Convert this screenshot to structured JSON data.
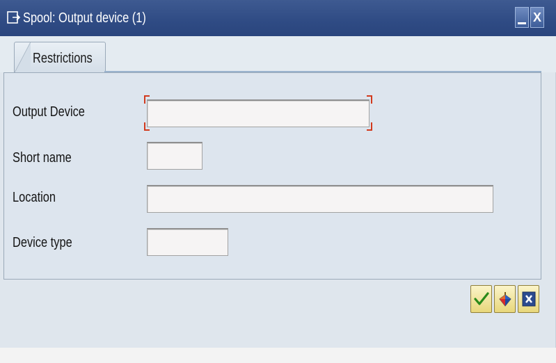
{
  "window": {
    "title": "Spool: Output device (1)",
    "title_icon": "dialog-icon",
    "minimize_icon": "minimize-icon",
    "close_label": "X"
  },
  "tabs": [
    {
      "label": "Restrictions",
      "active": true
    }
  ],
  "form": {
    "fields": [
      {
        "label": "Output Device",
        "value": "",
        "focused": true
      },
      {
        "label": "Short name",
        "value": ""
      },
      {
        "label": "Location",
        "value": ""
      },
      {
        "label": "Device type",
        "value": ""
      }
    ]
  },
  "actions": {
    "continue_icon": "checkmark-icon",
    "search_icon": "find-icon",
    "cancel_icon": "cancel-icon"
  },
  "colors": {
    "title_bar": "#2f4b84",
    "panel_bg": "#dde5ee",
    "focus_marker": "#d23a1d",
    "button_bg": "#e8d77b"
  }
}
